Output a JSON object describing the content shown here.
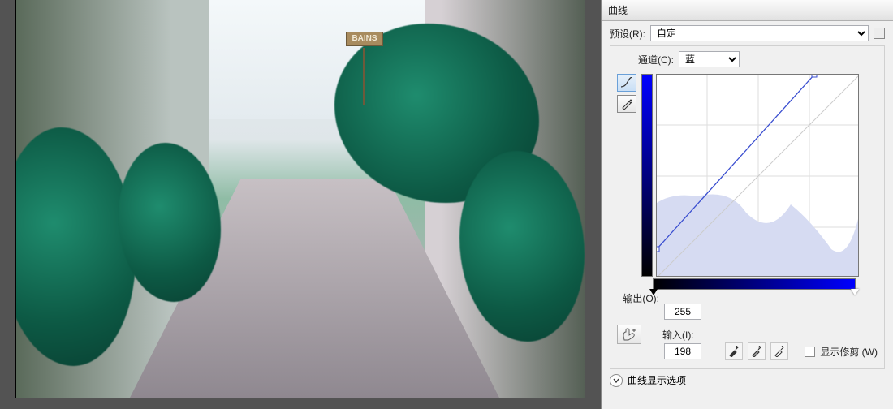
{
  "canvas": {
    "sign_text": "BAINS"
  },
  "dialog": {
    "title": "曲线",
    "preset": {
      "label": "预设(R):",
      "value": "自定"
    },
    "channel": {
      "label": "通道(C):",
      "value": "蓝"
    },
    "output": {
      "label": "输出(O):",
      "value": "255"
    },
    "input": {
      "label": "输入(I):",
      "value": "198"
    },
    "show_clipping": {
      "label": "显示修剪 (W)"
    },
    "display_options": "曲线显示选项",
    "curve_points": [
      {
        "in": 0,
        "out": 36
      },
      {
        "in": 198,
        "out": 255
      }
    ],
    "colors": {
      "channel_max": "#0000ff",
      "channel_min": "#000000",
      "curve": "#3a4ed0"
    }
  }
}
